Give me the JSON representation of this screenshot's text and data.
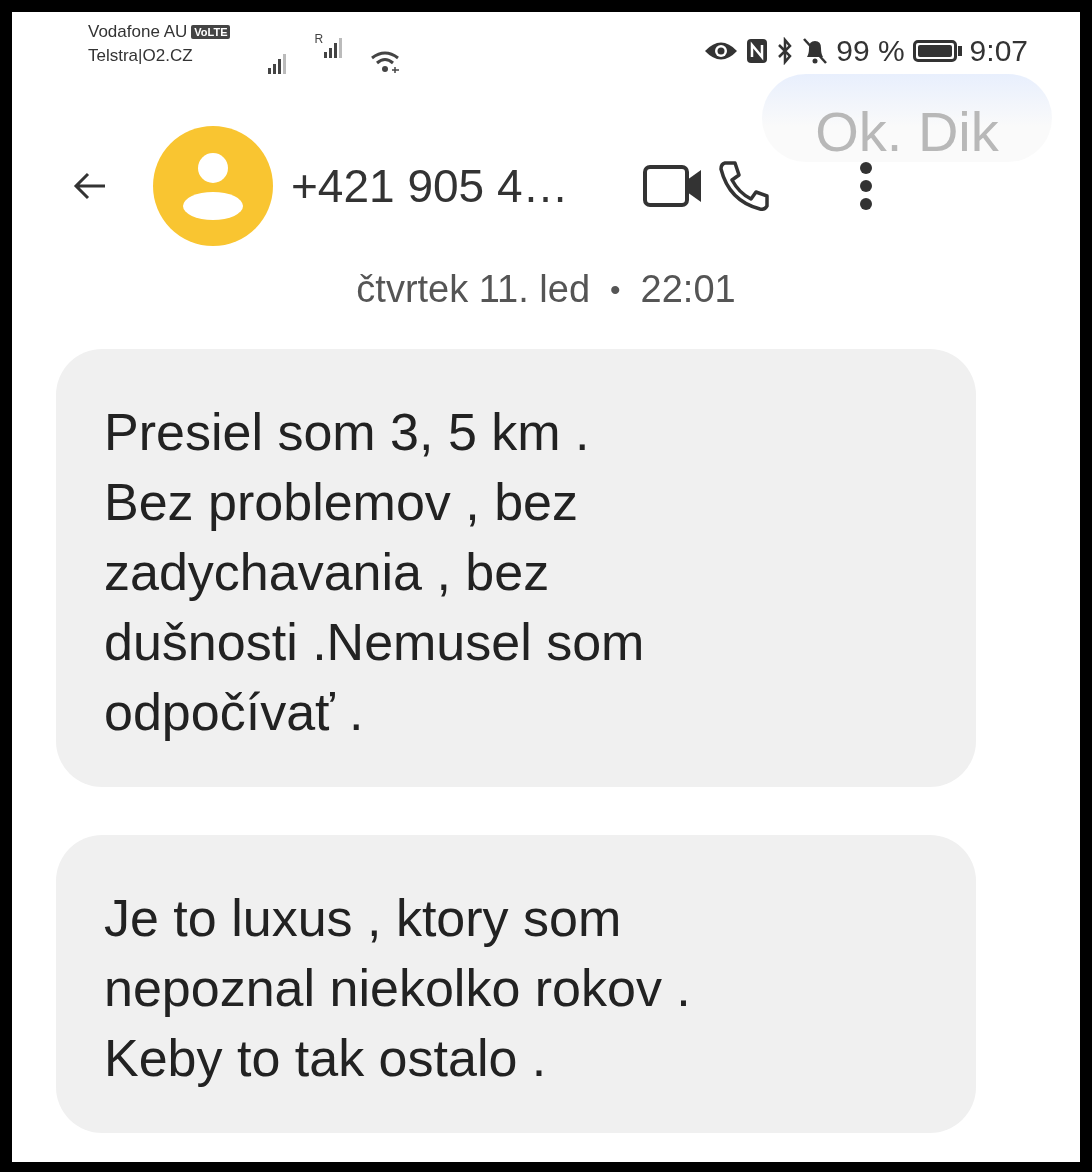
{
  "status_bar": {
    "carriers": [
      "Vodafone AU",
      "Telstra|O2.CZ"
    ],
    "volte_badge": "VoLTE",
    "roaming_mark": "R",
    "battery_text": "99 %",
    "time": "9:07"
  },
  "notification_preview": "Ok. Dik",
  "header": {
    "contact": "+421 905 4…"
  },
  "date_divider": {
    "day": "čtvrtek 11. led",
    "separator": "•",
    "time": "22:01"
  },
  "messages": [
    {
      "lines": [
        "Presiel som  3, 5 km .",
        "Bez problemov , bez",
        "zadychavania , bez",
        "dušnosti .Nemusel som",
        "odpočívať ."
      ]
    },
    {
      "lines": [
        "Je to luxus , ktory som",
        "nepoznal niekolko rokov .",
        "Keby to tak ostalo ."
      ]
    }
  ]
}
